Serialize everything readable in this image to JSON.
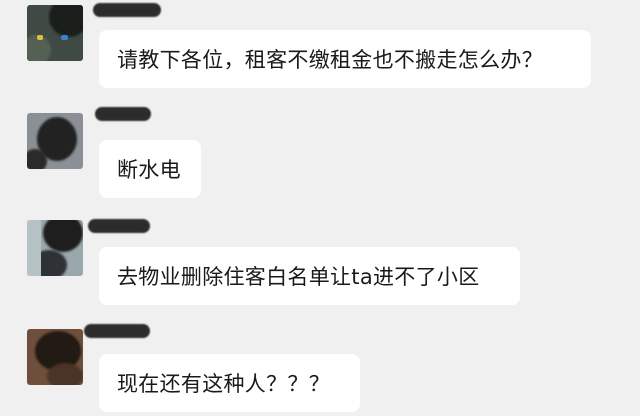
{
  "messages": [
    {
      "text": "请教下各位，租客不缴租金也不搬走怎么办？"
    },
    {
      "text": "断水电"
    },
    {
      "text": "去物业删除住客白名单让ta进不了小区"
    },
    {
      "text": "现在还有这种人？？？"
    }
  ]
}
